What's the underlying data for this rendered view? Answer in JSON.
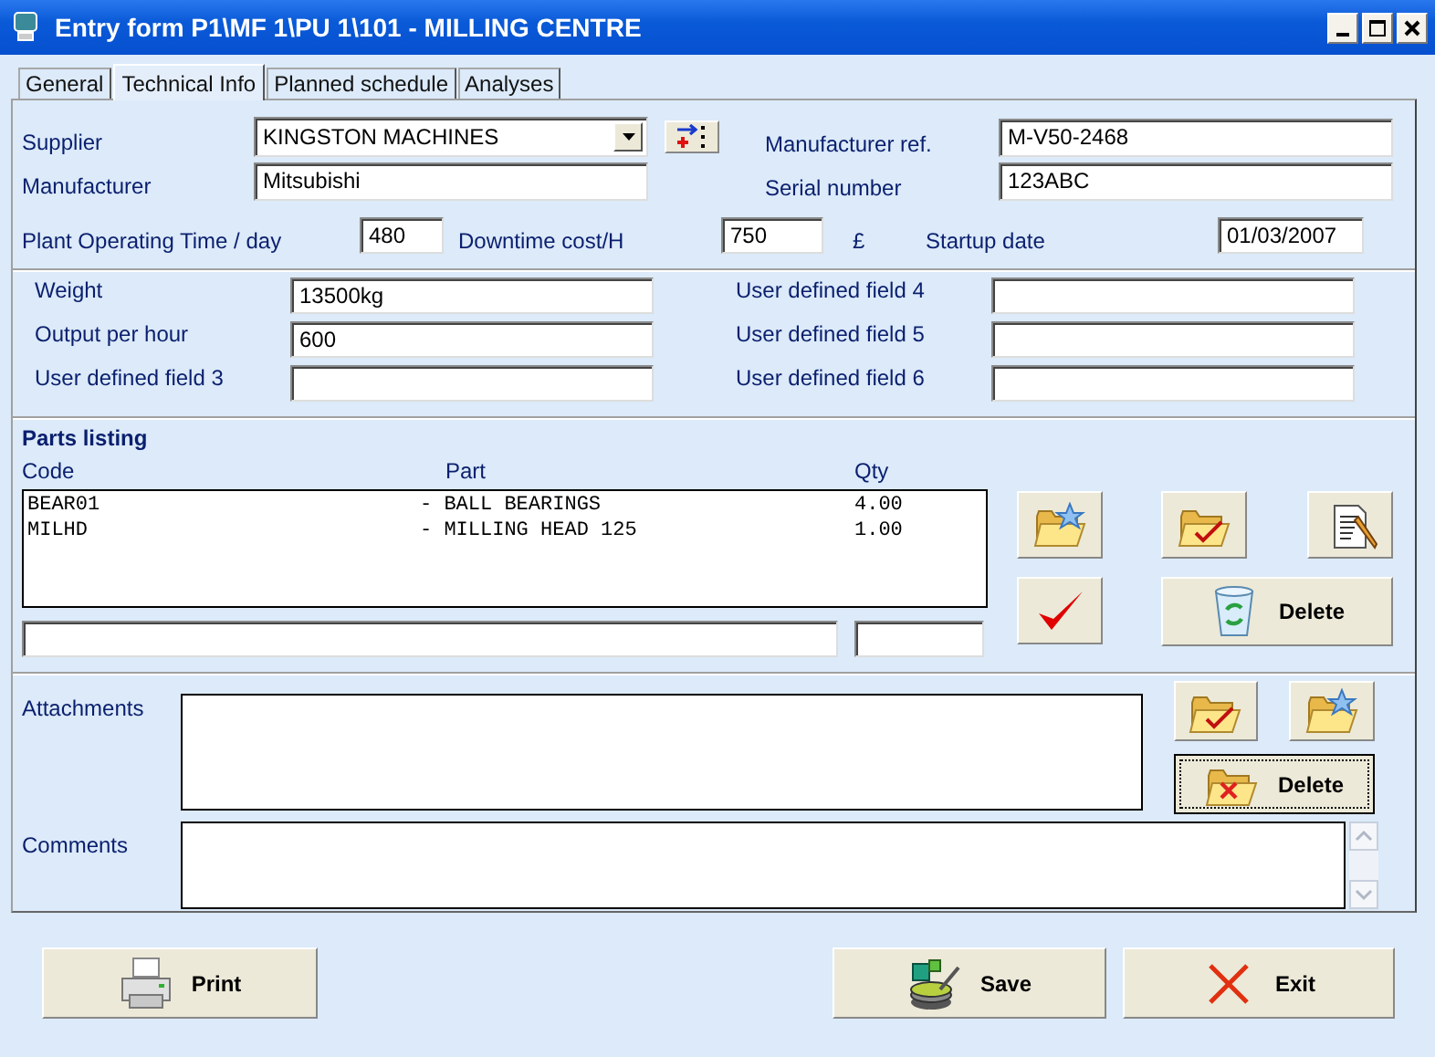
{
  "window": {
    "title": "Entry form P1\\MF 1\\PU 1\\101 - MILLING CENTRE"
  },
  "tabs": [
    {
      "label": "General",
      "selected": false
    },
    {
      "label": "Technical Info",
      "selected": true
    },
    {
      "label": "Planned schedule",
      "selected": false
    },
    {
      "label": "Analyses",
      "selected": false
    }
  ],
  "supplier": {
    "label": "Supplier",
    "value": "KINGSTON MACHINES"
  },
  "manufacturer": {
    "label": "Manufacturer",
    "value": "Mitsubishi"
  },
  "manufacturer_ref": {
    "label": "Manufacturer ref.",
    "value": "M-V50-2468"
  },
  "serial_number": {
    "label": "Serial number",
    "value": "123ABC"
  },
  "operating_time": {
    "label": "Plant Operating Time / day",
    "value": "480"
  },
  "downtime_cost": {
    "label": "Downtime cost/H",
    "value": "750",
    "unit": "£"
  },
  "startup_date": {
    "label": "Startup date",
    "value": "01/03/2007"
  },
  "user_fields": [
    {
      "label": "Weight",
      "value": "13500kg"
    },
    {
      "label": "User defined field 4"
    },
    {
      "label": "Output per hour",
      "value": "600"
    },
    {
      "label": "User defined field 5"
    },
    {
      "label": "User defined field 3"
    },
    {
      "label": "User defined field 6"
    }
  ],
  "parts": {
    "title": "Parts listing",
    "columns": [
      "Code",
      "Part",
      "Qty"
    ],
    "rows": [
      {
        "code": "BEAR01",
        "part": "- BALL BEARINGS",
        "qty": "4.00"
      },
      {
        "code": "MILHD",
        "part": "- MILLING HEAD 125",
        "qty": "1.00"
      }
    ],
    "delete_button": "Delete"
  },
  "attachments": {
    "label": "Attachments",
    "delete_button": "Delete",
    "delete_focused": true
  },
  "comments": {
    "label": "Comments"
  },
  "footer": [
    {
      "kind": "print",
      "label": "Print"
    },
    {
      "kind": "save",
      "label": "Save"
    },
    {
      "kind": "exit",
      "label": "Exit"
    }
  ]
}
